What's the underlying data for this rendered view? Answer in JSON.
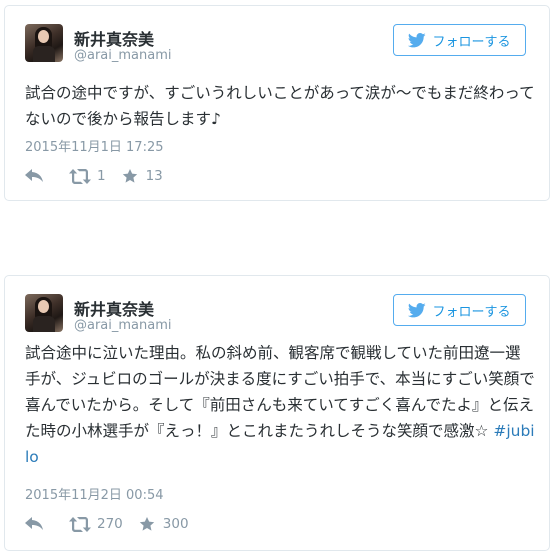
{
  "tweets": [
    {
      "name": "新井真奈美",
      "handle": "@arai_manami",
      "follow_label": "フォローする",
      "text": "試合の途中ですが、すごいうれしいことがあって涙が〜でもまだ終わってないので後から報告します♪",
      "hashtag": "",
      "date": "2015年11月1日 17:25",
      "retweets": "1",
      "favorites": "13"
    },
    {
      "name": "新井真奈美",
      "handle": "@arai_manami",
      "follow_label": "フォローする",
      "text": "試合途中に泣いた理由。私の斜め前、観客席で観戦していた前田遼一選手が、ジュビロのゴールが決まる度にすごい拍手で、本当にすごい笑顔で喜んでいたから。そして『前田さんも来ていてすごく喜んでたよ』と伝えた時の小林選手が『えっ！』とこれまたうれしそうな笑顔で感激☆ ",
      "hashtag": "#jubilo",
      "date": "2015年11月2日 00:54",
      "retweets": "270",
      "favorites": "300"
    }
  ],
  "colors": {
    "accent": "#55acee",
    "link": "#2b7bb9",
    "meta": "#8899a6",
    "border": "#e1e8ed"
  },
  "icons": [
    "twitter-bird-icon",
    "reply-icon",
    "retweet-icon",
    "star-icon"
  ]
}
